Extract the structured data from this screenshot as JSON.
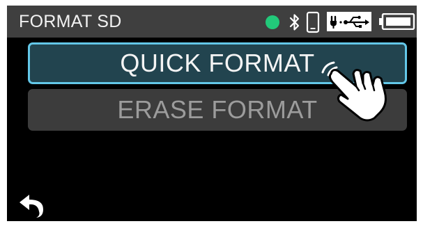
{
  "header": {
    "title": "FORMAT SD"
  },
  "status_bar": {
    "icons": [
      "status-dot-icon",
      "bluetooth-icon",
      "phone-icon",
      "usb-power-icon",
      "battery-icon"
    ],
    "status_dot_color": "#22c97a"
  },
  "menu": {
    "items": [
      {
        "label": "QUICK FORMAT",
        "selected": true
      },
      {
        "label": "ERASE FORMAT",
        "selected": false
      }
    ]
  },
  "footer": {
    "back_icon": "back-arrow-icon"
  },
  "overlay": {
    "pointer_icon": "tap-hand-icon"
  },
  "colors": {
    "header_bg": "#3f3f3f",
    "screen_bg": "#000000",
    "selected_bg": "#22444f",
    "selected_border": "#63c7e8",
    "unselected_bg": "#3c3c3c",
    "unselected_text": "#9c9c9c"
  }
}
